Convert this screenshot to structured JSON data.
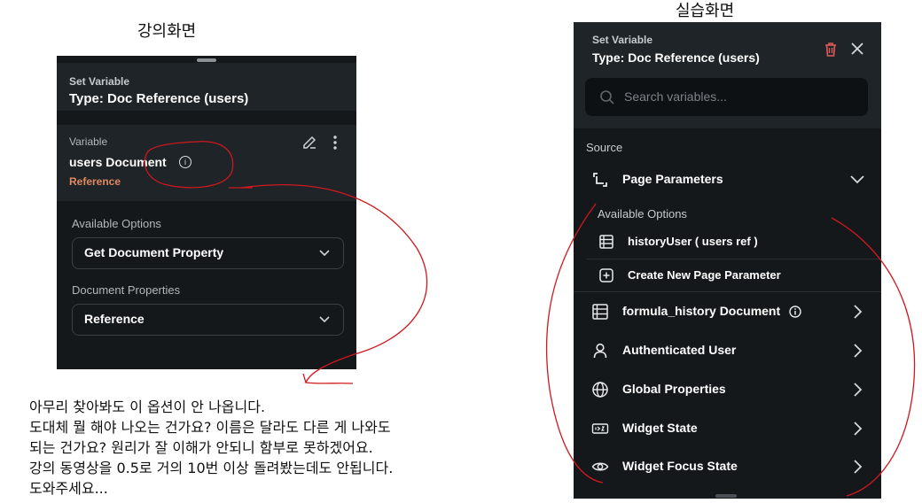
{
  "captions": {
    "left": "강의화면",
    "right": "실습화면"
  },
  "lecture_panel": {
    "header": {
      "set_variable": "Set Variable",
      "type": "Type: Doc Reference (users)"
    },
    "variable": {
      "label": "Variable",
      "name": "users Document",
      "subtype": "Reference"
    },
    "available_options": {
      "label": "Available Options",
      "value": "Get Document Property"
    },
    "document_properties": {
      "label": "Document Properties",
      "value": "Reference"
    }
  },
  "question": {
    "lines": [
      "아무리 찾아봐도 이 옵션이 안 나옵니다.",
      "도대체 뭘 해야 나오는 건가요? 이름은 달라도 다른 게 나와도",
      "되는 건가요? 원리가 잘 이해가 안되니 함부로 못하겠어요.",
      "강의 동영상을 0.5로 거의 10번 이상 돌려봤는데도 안됩니다.",
      "도와주세요..."
    ]
  },
  "practice_panel": {
    "header": {
      "set_variable": "Set Variable",
      "type": "Type: Doc Reference (users)"
    },
    "search": {
      "placeholder": "Search variables..."
    },
    "source_label": "Source",
    "page_parameters": {
      "label": "Page Parameters",
      "available_label": "Available Options",
      "items": [
        {
          "label": "historyUser   ( users ref )",
          "icon": "table-icon"
        },
        {
          "label": "Create New Page Parameter",
          "icon": "plus-square-icon"
        }
      ]
    },
    "sources": [
      {
        "label": "formula_history Document",
        "icon": "table-icon"
      },
      {
        "label": "Authenticated User",
        "icon": "person-icon"
      },
      {
        "label": "Global Properties",
        "icon": "globe-icon"
      },
      {
        "label": "Widget State",
        "icon": "widget-state-icon"
      },
      {
        "label": "Widget Focus State",
        "icon": "eye-icon"
      }
    ]
  },
  "colors": {
    "panel_bg": "#14181b",
    "panel_header": "#1e2428",
    "reference_orange": "#e08a5e",
    "delete_red": "#e05a5a",
    "annotation_red": "#d0181e"
  }
}
